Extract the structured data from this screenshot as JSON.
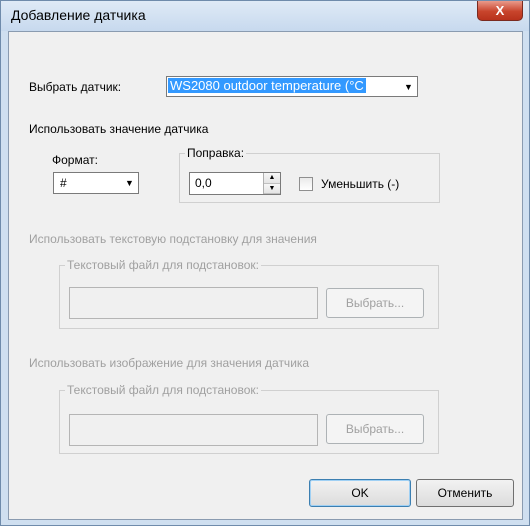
{
  "window": {
    "title": "Добавление датчика",
    "close_glyph": "X"
  },
  "sensor": {
    "label": "Выбрать датчик:",
    "selected": "WS2080 outdoor temperature (°C"
  },
  "value_section": {
    "title": "Использовать значение датчика",
    "format_label": "Формат:",
    "format_value": "#",
    "correction_label": "Поправка:",
    "correction_value": "0,0",
    "decrease_label": "Уменьшить (-)"
  },
  "text_section": {
    "title": "Использовать текстовую подстановку для значения",
    "group_label": "Текстовый файл для подстановок:",
    "browse": "Выбрать..."
  },
  "image_section": {
    "title": "Использовать изображение для значения датчика",
    "group_label": "Текстовый файл для подстановок:",
    "browse": "Выбрать..."
  },
  "buttons": {
    "ok": "OK",
    "cancel": "Отменить"
  },
  "icons": {
    "dropdown": "chevron-down-icon",
    "spin_up": "spin-up-icon",
    "spin_down": "spin-down-icon",
    "close": "close-icon"
  }
}
